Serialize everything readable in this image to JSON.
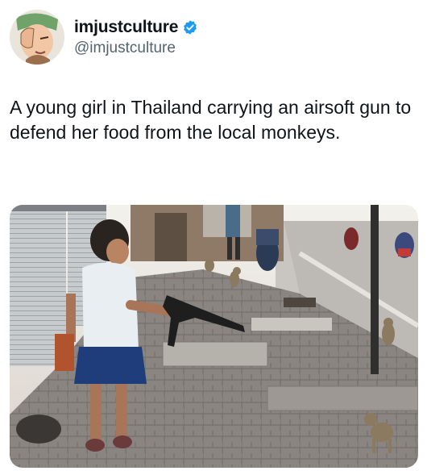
{
  "author": {
    "display_name": "imjustculture",
    "handle": "@imjustculture",
    "avatar_icon": "anime-character-facepalm-icon",
    "verified_icon": "verified-badge-icon",
    "verified_color": "#1d9bf0"
  },
  "tweet": {
    "text": "A young girl in Thailand carrying an airsoft gun to defend her food from the local monkeys."
  },
  "media": {
    "icon": "photo-girl-with-airsoft-gun-and-monkeys"
  }
}
